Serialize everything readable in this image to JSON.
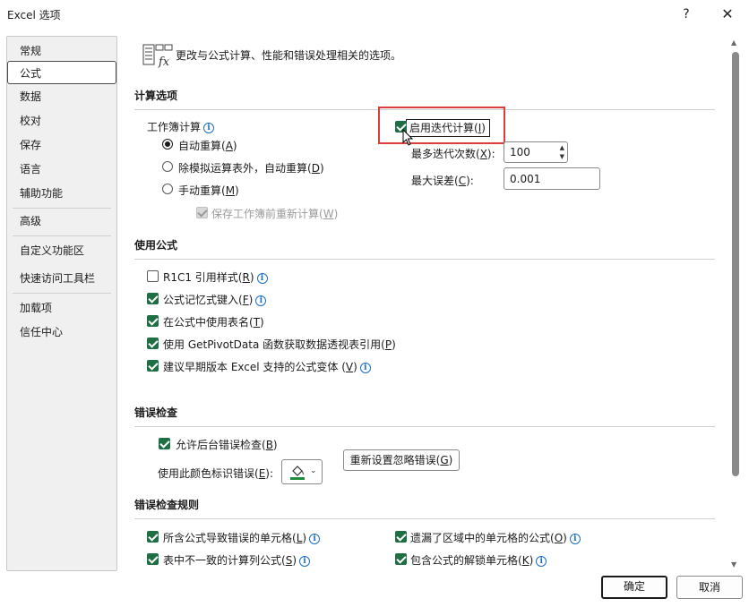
{
  "window": {
    "title": "Excel 选项",
    "help_glyph": "?",
    "close_glyph": "✕"
  },
  "sidebar": {
    "items": [
      {
        "label": "常规"
      },
      {
        "label": "公式"
      },
      {
        "label": "数据"
      },
      {
        "label": "校对"
      },
      {
        "label": "保存"
      },
      {
        "label": "语言"
      },
      {
        "label": "辅助功能"
      },
      {
        "label": "高级"
      },
      {
        "label": "自定义功能区"
      },
      {
        "label": "快速访问工具栏"
      },
      {
        "label": "加载项"
      },
      {
        "label": "信任中心"
      }
    ],
    "selected": "公式"
  },
  "header": {
    "text": "更改与公式计算、性能和错误处理相关的选项。",
    "icon": "formula-fx-icon"
  },
  "calc": {
    "title": "计算选项",
    "workbook_label": "工作簿计算",
    "auto": {
      "text": "自动重算(",
      "key": "A",
      "close": ")"
    },
    "auto_except": {
      "text": "除模拟运算表外，自动重算(",
      "key": "D",
      "close": ")"
    },
    "manual": {
      "text": "手动重算(",
      "key": "M",
      "close": ")"
    },
    "recalc_before_save": {
      "text": "保存工作簿前重新计算(",
      "key": "W",
      "close": ")"
    },
    "iterative": {
      "text": "启用迭代计算(",
      "key": "I",
      "close": ")"
    },
    "max_iter": {
      "text": "最多迭代次数(",
      "key": "X",
      "close": "):",
      "value": "100"
    },
    "max_change": {
      "text": "最大误差(",
      "key": "C",
      "close": "):",
      "value": "0.001"
    }
  },
  "formulas": {
    "title": "使用公式",
    "r1c1": {
      "text": "R1C1 引用样式(",
      "key": "R",
      "close": ")"
    },
    "autocomplete": {
      "text": "公式记忆式键入(",
      "key": "F",
      "close": ")"
    },
    "table_names": {
      "text": "在公式中使用表名(",
      "key": "T",
      "close": ")"
    },
    "getpivot": {
      "text": "使用 GetPivotData 函数获取数据透视表引用(",
      "key": "P",
      "close": ")"
    },
    "suggest": {
      "text": "建议早期版本 Excel 支持的公式变体 (",
      "key": "V",
      "close": ")"
    }
  },
  "errors": {
    "title": "错误检查",
    "background": {
      "text": "允许后台错误检查(",
      "key": "B",
      "close": ")"
    },
    "color_label": {
      "text": "使用此颜色标识错误(",
      "key": "E",
      "close": "):"
    },
    "reset_button": {
      "text": "重新设置忽略错误(",
      "key": "G",
      "close": ")"
    },
    "color": "#1e8a3c"
  },
  "rules": {
    "title": "错误检查规则",
    "r1": {
      "text": "所含公式导致错误的单元格(",
      "key": "L",
      "close": ")"
    },
    "r2": {
      "text": "表中不一致的计算列公式(",
      "key": "S",
      "close": ")"
    },
    "r3": {
      "text": "遗漏了区域中的单元格的公式(",
      "key": "O",
      "close": ")"
    },
    "r4": {
      "text": "包含公式的解锁单元格(",
      "key": "K",
      "close": ")"
    }
  },
  "footer": {
    "ok": "确定",
    "cancel": "取消"
  },
  "colors": {
    "accent_green": "#1e6f44",
    "highlight_red": "#e03c3c",
    "info_blue": "#1a6fc4"
  }
}
